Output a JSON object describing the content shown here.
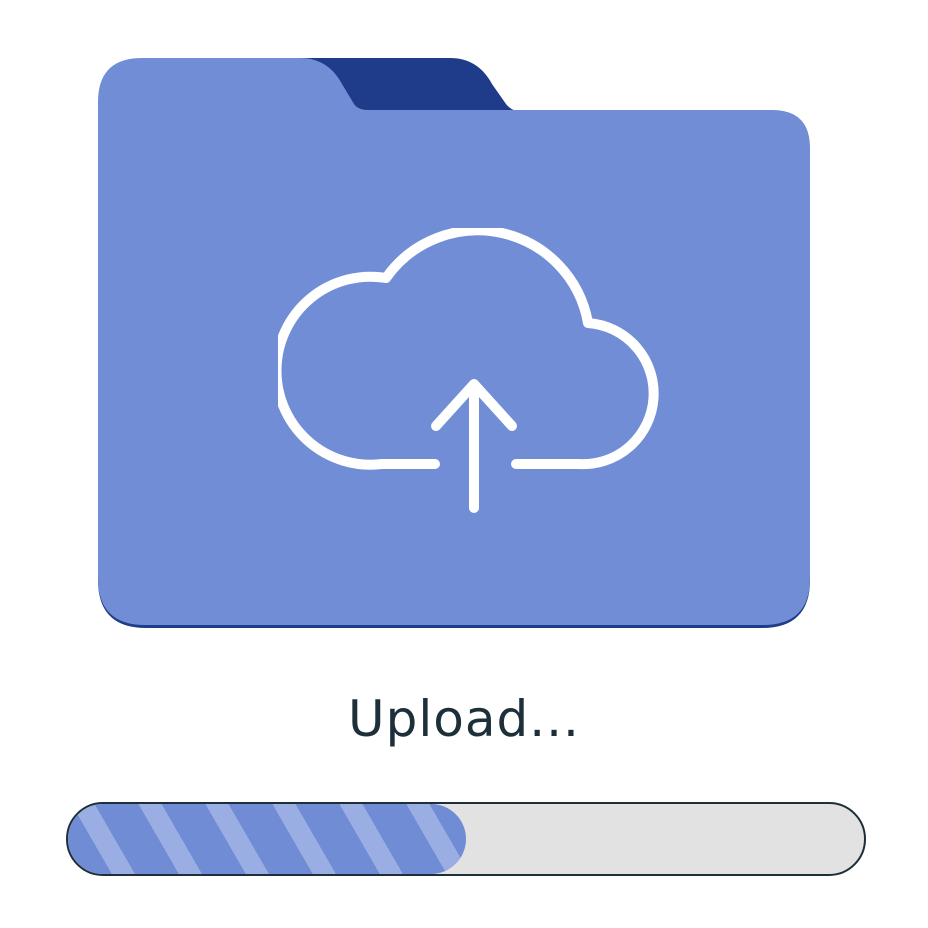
{
  "upload": {
    "status_text": "Upload...",
    "progress_fraction": 0.5
  },
  "icons": {
    "folder": "folder-icon",
    "cloud_upload": "cloud-upload-icon"
  },
  "colors": {
    "folder_body": "#718dd5",
    "folder_tab": "#1f3c8a",
    "progress_fill": "#6f8cd5",
    "progress_stripe": "#9aaee3",
    "progress_track": "#e2e2e2",
    "outline": "#1d2f38",
    "icon_stroke": "#ffffff"
  }
}
